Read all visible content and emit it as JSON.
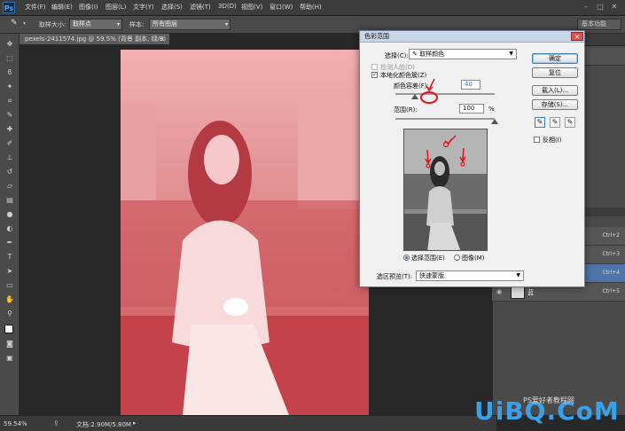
{
  "menubar": {
    "logo": "Ps",
    "items": [
      "文件(F)",
      "编辑(E)",
      "图像(I)",
      "图层(L)",
      "文字(Y)",
      "选择(S)",
      "滤镜(T)",
      "3D(D)",
      "视图(V)",
      "窗口(W)",
      "帮助(H)"
    ]
  },
  "options": {
    "sample_size_label": "取样大小:",
    "sample_size_value": "取样点",
    "sample_label": "样本:",
    "sample_value": "所有图层",
    "workspace": "基本功能"
  },
  "document": {
    "tab_title": "pexels-2411574.jpg @ 59.5% (背景 副本, 绿/8) *",
    "close": "×"
  },
  "status": {
    "zoom": "59.54%",
    "doc_info": "文档:2.90M/5.80M"
  },
  "layers": {
    "rows": [
      {
        "name": "",
        "shortcut": "Ctrl+2"
      },
      {
        "name": "",
        "shortcut": "Ctrl+3"
      },
      {
        "name": "",
        "shortcut": "Ctrl+4"
      },
      {
        "name": "蓝",
        "shortcut": "Ctrl+5"
      }
    ]
  },
  "dialog": {
    "title": "色彩范围",
    "select_label": "选择(C):",
    "select_value": "取样颜色",
    "detect_faces": "检测人脸(D)",
    "localized_clusters": "本地化颜色簇(Z)",
    "fuzziness_label": "颜色容差(F):",
    "fuzziness_value": "40",
    "range_label": "范围(R):",
    "range_value": "100",
    "range_unit": "%",
    "ok": "确定",
    "reset": "复位",
    "load": "载入(L)...",
    "save": "存储(S)...",
    "invert": "反相(I)",
    "radio_selection": "选择范围(E)",
    "radio_image": "图像(M)",
    "preview_label": "选区预览(T):",
    "preview_value": "快速蒙版",
    "fuzziness_level": 0.2,
    "range_level": 1.0
  },
  "watermark": {
    "text": "UiBQ.CoM",
    "sub": "PS爱好者教程网"
  },
  "colors": {
    "ps_blue": "#4aa8ff",
    "photo_red": "#d8585e",
    "annotation_red": "#e0151b"
  }
}
